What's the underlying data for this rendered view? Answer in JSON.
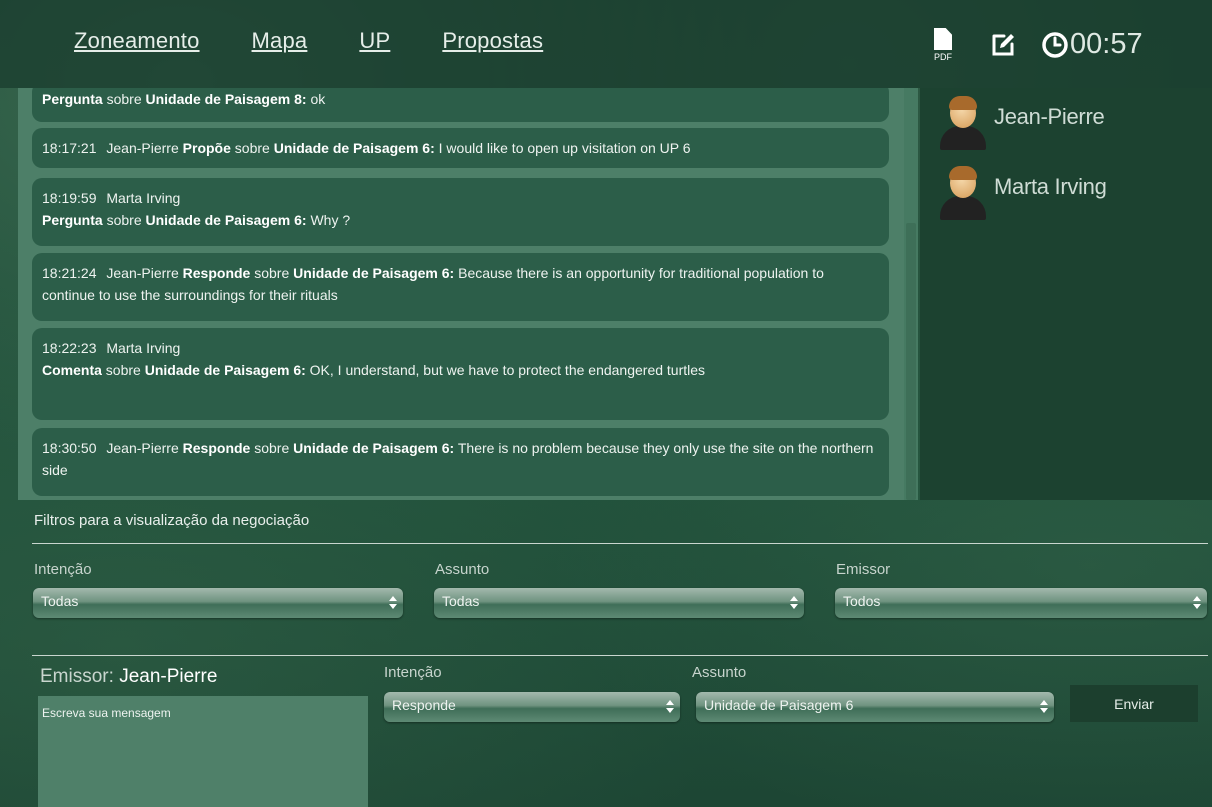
{
  "nav": {
    "items": [
      "Zoneamento",
      "Mapa",
      "UP",
      "Propostas"
    ]
  },
  "toolbar": {
    "pdf_label": "PDF",
    "timer": "00:57"
  },
  "messages": [
    {
      "time": "",
      "sender": "",
      "intent": "Pergunta",
      "about": "sobre",
      "subject": "Unidade de Paisagem 8:",
      "text": "ok"
    },
    {
      "time": "18:17:21",
      "sender": "Jean-Pierre",
      "intent": "Propõe",
      "about": "sobre",
      "subject": "Unidade de Paisagem 6:",
      "text": "I would like to open up visitation on UP 6"
    },
    {
      "time": "18:19:59",
      "sender": "Marta Irving",
      "intent": "Pergunta",
      "about": "sobre",
      "subject": "Unidade de Paisagem 6:",
      "text": "Why ?"
    },
    {
      "time": "18:21:24",
      "sender": "Jean-Pierre",
      "intent": "Responde",
      "about": "sobre",
      "subject": "Unidade de Paisagem 6:",
      "text": "Because there is an opportunity for traditional population to continue to use the surroundings for their rituals"
    },
    {
      "time": "18:22:23",
      "sender": "Marta Irving",
      "intent": "Comenta",
      "about": "sobre",
      "subject": "Unidade de Paisagem 6:",
      "text": "OK, I understand, but we have to protect the endangered turtles"
    },
    {
      "time": "18:30:50",
      "sender": "Jean-Pierre",
      "intent": "Responde",
      "about": "sobre",
      "subject": "Unidade de Paisagem 6:",
      "text": "There is no problem because they only use the site on the northern side"
    }
  ],
  "participants": [
    "Jean-Pierre",
    "Marta Irving"
  ],
  "filters": {
    "title": "Filtros para a visualização da negociação",
    "intencao_label": "Intenção",
    "intencao_value": "Todas",
    "assunto_label": "Assunto",
    "assunto_value": "Todas",
    "emissor_label": "Emissor",
    "emissor_value": "Todos"
  },
  "compose": {
    "emissor_label": "Emissor:",
    "emissor_name": "Jean-Pierre",
    "message_placeholder": "Escreva sua mensagem",
    "intencao_label": "Intenção",
    "intencao_value": "Responde",
    "assunto_label": "Assunto",
    "assunto_value": "Unidade de Paisagem 6",
    "send_label": "Enviar"
  }
}
